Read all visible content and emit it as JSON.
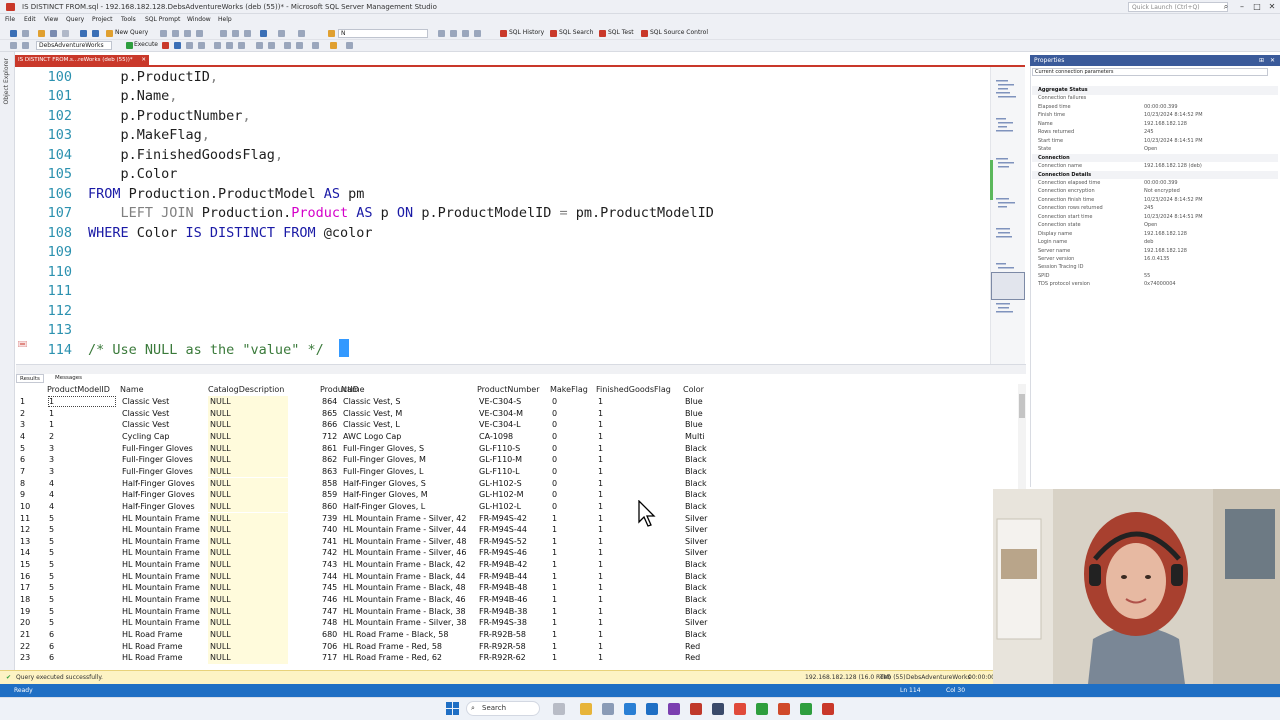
{
  "window": {
    "title": "IS DISTINCT FROM.sql - 192.168.182.128.DebsAdventureWorks (deb (55))* - Microsoft SQL Server Management Studio",
    "quick_launch_placeholder": "Quick Launch (Ctrl+Q)"
  },
  "menu": [
    "File",
    "Edit",
    "View",
    "Query",
    "Project",
    "Tools",
    "SQL Prompt",
    "Window",
    "Help"
  ],
  "toolbar": {
    "new_query": "New Query",
    "execute": "Execute",
    "database": "DebsAdventureWorks",
    "search_box": "N",
    "sql_history": "SQL History",
    "sql_search": "SQL Search",
    "sql_test": "SQL Test",
    "sql_source_control": "SQL Source Control"
  },
  "left_rail": {
    "object_explorer": "Object Explorer"
  },
  "document_tab": {
    "label": "IS DISTINCT FROM.s...reWorks (deb (55))*"
  },
  "editor": {
    "lines": [
      {
        "num": "100",
        "segs": [
          {
            "t": "    p.ProductID",
            "c": ""
          },
          {
            "t": ",",
            "c": "gr"
          }
        ]
      },
      {
        "num": "101",
        "segs": [
          {
            "t": "    p.Name",
            "c": ""
          },
          {
            "t": ",",
            "c": "gr"
          }
        ]
      },
      {
        "num": "102",
        "segs": [
          {
            "t": "    p.ProductNumber",
            "c": ""
          },
          {
            "t": ",",
            "c": "gr"
          }
        ]
      },
      {
        "num": "103",
        "segs": [
          {
            "t": "    p.MakeFlag",
            "c": ""
          },
          {
            "t": ",",
            "c": "gr"
          }
        ]
      },
      {
        "num": "104",
        "segs": [
          {
            "t": "    p.FinishedGoodsFlag",
            "c": ""
          },
          {
            "t": ",",
            "c": "gr"
          }
        ]
      },
      {
        "num": "105",
        "segs": [
          {
            "t": "    p.Color",
            "c": ""
          }
        ]
      },
      {
        "num": "106",
        "segs": [
          {
            "t": "FROM",
            "c": "kw"
          },
          {
            "t": " Production.ProductModel ",
            "c": ""
          },
          {
            "t": "AS",
            "c": "kw"
          },
          {
            "t": " pm",
            "c": ""
          }
        ]
      },
      {
        "num": "107",
        "segs": [
          {
            "t": "    LEFT JOIN",
            "c": "gr"
          },
          {
            "t": " Production.",
            "c": ""
          },
          {
            "t": "Product",
            "c": "pk"
          },
          {
            "t": " ",
            "c": ""
          },
          {
            "t": "AS",
            "c": "kw"
          },
          {
            "t": " p ",
            "c": ""
          },
          {
            "t": "ON",
            "c": "kw"
          },
          {
            "t": " p.ProductModelID ",
            "c": ""
          },
          {
            "t": "=",
            "c": "gr"
          },
          {
            "t": " pm.ProductModelID",
            "c": ""
          }
        ]
      },
      {
        "num": "108",
        "segs": [
          {
            "t": "WHERE",
            "c": "kw"
          },
          {
            "t": " Color ",
            "c": ""
          },
          {
            "t": "IS DISTINCT FROM",
            "c": "kw"
          },
          {
            "t": " @color",
            "c": ""
          }
        ]
      },
      {
        "num": "109",
        "segs": []
      },
      {
        "num": "110",
        "segs": []
      },
      {
        "num": "111",
        "segs": []
      },
      {
        "num": "112",
        "segs": []
      },
      {
        "num": "113",
        "segs": []
      },
      {
        "num": "114",
        "segs": [
          {
            "t": "/* Use NULL as the \"value\" */",
            "c": "cm"
          }
        ]
      }
    ]
  },
  "results": {
    "tabs": {
      "results": "Results",
      "messages": "Messages"
    },
    "columns": [
      "ProductModelID",
      "Name",
      "CatalogDescription",
      "ProductID",
      "Name",
      "ProductNumber",
      "MakeFlag",
      "FinishedGoodsFlag",
      "Color"
    ],
    "rows": [
      [
        "1",
        "1",
        "Classic Vest",
        "NULL",
        "864",
        "Classic Vest, S",
        "VE-C304-S",
        "0",
        "1",
        "Blue"
      ],
      [
        "2",
        "1",
        "Classic Vest",
        "NULL",
        "865",
        "Classic Vest, M",
        "VE-C304-M",
        "0",
        "1",
        "Blue"
      ],
      [
        "3",
        "1",
        "Classic Vest",
        "NULL",
        "866",
        "Classic Vest, L",
        "VE-C304-L",
        "0",
        "1",
        "Blue"
      ],
      [
        "4",
        "2",
        "Cycling Cap",
        "NULL",
        "712",
        "AWC Logo Cap",
        "CA-1098",
        "0",
        "1",
        "Multi"
      ],
      [
        "5",
        "3",
        "Full-Finger Gloves",
        "NULL",
        "861",
        "Full-Finger Gloves, S",
        "GL-F110-S",
        "0",
        "1",
        "Black"
      ],
      [
        "6",
        "3",
        "Full-Finger Gloves",
        "NULL",
        "862",
        "Full-Finger Gloves, M",
        "GL-F110-M",
        "0",
        "1",
        "Black"
      ],
      [
        "7",
        "3",
        "Full-Finger Gloves",
        "NULL",
        "863",
        "Full-Finger Gloves, L",
        "GL-F110-L",
        "0",
        "1",
        "Black"
      ],
      [
        "8",
        "4",
        "Half-Finger Gloves",
        "NULL",
        "858",
        "Half-Finger Gloves, S",
        "GL-H102-S",
        "0",
        "1",
        "Black"
      ],
      [
        "9",
        "4",
        "Half-Finger Gloves",
        "NULL",
        "859",
        "Half-Finger Gloves, M",
        "GL-H102-M",
        "0",
        "1",
        "Black"
      ],
      [
        "10",
        "4",
        "Half-Finger Gloves",
        "NULL",
        "860",
        "Half-Finger Gloves, L",
        "GL-H102-L",
        "0",
        "1",
        "Black"
      ],
      [
        "11",
        "5",
        "HL Mountain Frame",
        "NULL",
        "739",
        "HL Mountain Frame - Silver, 42",
        "FR-M94S-42",
        "1",
        "1",
        "Silver"
      ],
      [
        "12",
        "5",
        "HL Mountain Frame",
        "NULL",
        "740",
        "HL Mountain Frame - Silver, 44",
        "FR-M94S-44",
        "1",
        "1",
        "Silver"
      ],
      [
        "13",
        "5",
        "HL Mountain Frame",
        "NULL",
        "741",
        "HL Mountain Frame - Silver, 48",
        "FR-M94S-52",
        "1",
        "1",
        "Silver"
      ],
      [
        "14",
        "5",
        "HL Mountain Frame",
        "NULL",
        "742",
        "HL Mountain Frame - Silver, 46",
        "FR-M94S-46",
        "1",
        "1",
        "Silver"
      ],
      [
        "15",
        "5",
        "HL Mountain Frame",
        "NULL",
        "743",
        "HL Mountain Frame - Black, 42",
        "FR-M94B-42",
        "1",
        "1",
        "Black"
      ],
      [
        "16",
        "5",
        "HL Mountain Frame",
        "NULL",
        "744",
        "HL Mountain Frame - Black, 44",
        "FR-M94B-44",
        "1",
        "1",
        "Black"
      ],
      [
        "17",
        "5",
        "HL Mountain Frame",
        "NULL",
        "745",
        "HL Mountain Frame - Black, 48",
        "FR-M94B-48",
        "1",
        "1",
        "Black"
      ],
      [
        "18",
        "5",
        "HL Mountain Frame",
        "NULL",
        "746",
        "HL Mountain Frame - Black, 46",
        "FR-M94B-46",
        "1",
        "1",
        "Black"
      ],
      [
        "19",
        "5",
        "HL Mountain Frame",
        "NULL",
        "747",
        "HL Mountain Frame - Black, 38",
        "FR-M94B-38",
        "1",
        "1",
        "Black"
      ],
      [
        "20",
        "5",
        "HL Mountain Frame",
        "NULL",
        "748",
        "HL Mountain Frame - Silver, 38",
        "FR-M94S-38",
        "1",
        "1",
        "Silver"
      ],
      [
        "21",
        "6",
        "HL Road Frame",
        "NULL",
        "680",
        "HL Road Frame - Black, 58",
        "FR-R92B-58",
        "1",
        "1",
        "Black"
      ],
      [
        "22",
        "6",
        "HL Road Frame",
        "NULL",
        "706",
        "HL Road Frame - Red, 58",
        "FR-R92R-58",
        "1",
        "1",
        "Red"
      ],
      [
        "23",
        "6",
        "HL Road Frame",
        "NULL",
        "717",
        "HL Road Frame - Red, 62",
        "FR-R92R-62",
        "1",
        "1",
        "Red"
      ]
    ]
  },
  "query_status": {
    "message": "Query executed successfully.",
    "server": "192.168.182.128 (16.0 RTM)",
    "user": "deb (55)",
    "database": "DebsAdventureWorks",
    "elapsed": "00:00:00"
  },
  "status_bar": {
    "left": "Ready",
    "line": "Ln 114",
    "col": "Col 30"
  },
  "properties": {
    "title": "Properties",
    "selector": "Current connection parameters",
    "rows": [
      {
        "type": "section",
        "k": "Aggregate Status",
        "v": ""
      },
      {
        "type": "row",
        "k": "Connection failures",
        "v": ""
      },
      {
        "type": "row",
        "k": "Elapsed time",
        "v": "00:00:00.399"
      },
      {
        "type": "row",
        "k": "Finish time",
        "v": "10/23/2024 8:14:52 PM"
      },
      {
        "type": "row",
        "k": "Name",
        "v": "192.168.182.128"
      },
      {
        "type": "row",
        "k": "Rows returned",
        "v": "245"
      },
      {
        "type": "row",
        "k": "Start time",
        "v": "10/23/2024 8:14:51 PM"
      },
      {
        "type": "row",
        "k": "State",
        "v": "Open"
      },
      {
        "type": "section",
        "k": "Connection",
        "v": ""
      },
      {
        "type": "row",
        "k": "Connection name",
        "v": "192.168.182.128 (deb)"
      },
      {
        "type": "section",
        "k": "Connection Details",
        "v": ""
      },
      {
        "type": "row",
        "k": "Connection elapsed time",
        "v": "00:00:00.399"
      },
      {
        "type": "row",
        "k": "Connection encryption",
        "v": "Not encrypted"
      },
      {
        "type": "row",
        "k": "Connection finish time",
        "v": "10/23/2024 8:14:52 PM"
      },
      {
        "type": "row",
        "k": "Connection rows returned",
        "v": "245"
      },
      {
        "type": "row",
        "k": "Connection start time",
        "v": "10/23/2024 8:14:51 PM"
      },
      {
        "type": "row",
        "k": "Connection state",
        "v": "Open"
      },
      {
        "type": "row",
        "k": "Display name",
        "v": "192.168.182.128"
      },
      {
        "type": "row",
        "k": "Login name",
        "v": "deb"
      },
      {
        "type": "row",
        "k": "Server name",
        "v": "192.168.182.128"
      },
      {
        "type": "row",
        "k": "Server version",
        "v": "16.0.4135"
      },
      {
        "type": "row",
        "k": "Session Tracing ID",
        "v": ""
      },
      {
        "type": "row",
        "k": "SPID",
        "v": "55"
      },
      {
        "type": "row",
        "k": "TDS protocol version",
        "v": "0x74000004"
      }
    ]
  },
  "taskbar": {
    "search_label": "Search"
  },
  "colors": {
    "accent_tab": "#c9382a",
    "status_bar": "#1f6fc4",
    "null_cell": "#fffbdc",
    "keyword": "#1a1aa6",
    "pink_object": "#d400c9"
  }
}
